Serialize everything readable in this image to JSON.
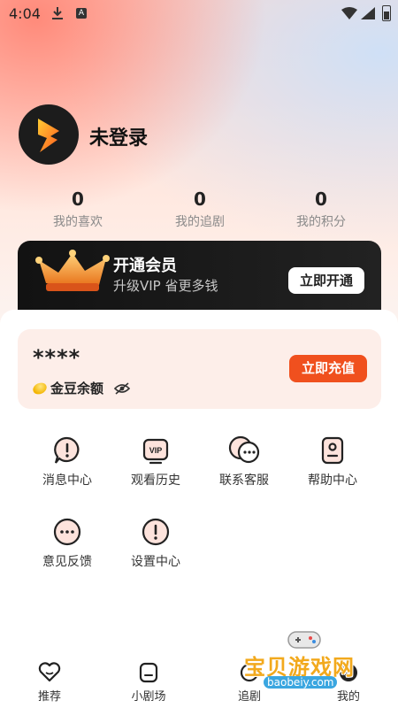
{
  "status_bar": {
    "time": "4:04",
    "a_badge": "A"
  },
  "profile": {
    "name": "未登录"
  },
  "stats": [
    {
      "value": "0",
      "label": "我的喜欢"
    },
    {
      "value": "0",
      "label": "我的追剧"
    },
    {
      "value": "0",
      "label": "我的积分"
    }
  ],
  "vip_banner": {
    "title": "开通会员",
    "subtitle": "升级VIP 省更多钱",
    "button": "立即开通"
  },
  "wallet": {
    "balance_masked": "****",
    "label": "金豆余额",
    "button": "立即充值"
  },
  "menu": [
    {
      "label": "消息中心",
      "icon": "exclamation-bubble-icon"
    },
    {
      "label": "观看历史",
      "icon": "vip-history-icon"
    },
    {
      "label": "联系客服",
      "icon": "chat-bubbles-icon"
    },
    {
      "label": "帮助中心",
      "icon": "help-doc-icon"
    },
    {
      "label": "意见反馈",
      "icon": "feedback-dots-icon"
    },
    {
      "label": "设置中心",
      "icon": "settings-exclamation-icon"
    }
  ],
  "bottom_nav": [
    {
      "label": "推荐",
      "icon": "heart-icon"
    },
    {
      "label": "小剧场",
      "icon": "theater-icon"
    },
    {
      "label": "追剧",
      "icon": "follow-icon"
    },
    {
      "label": "我的",
      "icon": "profile-icon"
    }
  ],
  "watermark": {
    "text": "宝贝游戏网",
    "url": "baobeiy.com"
  },
  "colors": {
    "accent": "#f0501e",
    "wallet_bg": "#fdeee9",
    "vip_bg": "#161616"
  }
}
